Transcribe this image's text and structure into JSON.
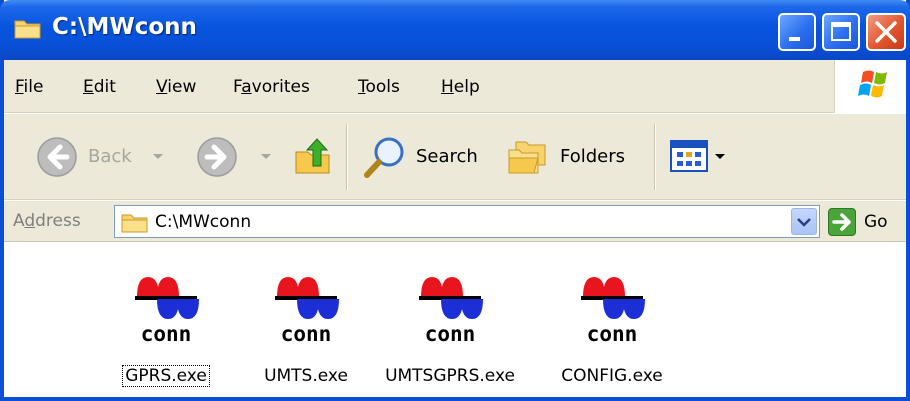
{
  "window": {
    "title": "C:\\MWconn"
  },
  "menu": [
    {
      "label": "File",
      "accel": "F",
      "rest": "ile"
    },
    {
      "label": "Edit",
      "accel": "E",
      "rest": "dit"
    },
    {
      "label": "View",
      "accel": "V",
      "rest": "iew"
    },
    {
      "label": "Favorites",
      "pre": "F",
      "accel": "a",
      "rest": "vorites"
    },
    {
      "label": "Tools",
      "accel": "T",
      "rest": "ools"
    },
    {
      "label": "Help",
      "accel": "H",
      "rest": "elp"
    }
  ],
  "toolbar": {
    "back_label": "Back",
    "search_label": "Search",
    "folders_label": "Folders"
  },
  "address": {
    "label_pre": "A",
    "label_accel": "d",
    "label_rest": "dress",
    "value": "C:\\MWconn",
    "go_label": "Go"
  },
  "files": [
    {
      "name": "GPRS.exe",
      "icon_text": "conn",
      "selected": true
    },
    {
      "name": "UMTS.exe",
      "icon_text": "conn",
      "selected": false
    },
    {
      "name": "UMTSGPRS.exe",
      "icon_text": "conn",
      "selected": false
    },
    {
      "name": "CONFIG.exe",
      "icon_text": "conn",
      "selected": false
    }
  ],
  "colors": {
    "titlebar": "#0a50d8",
    "chrome": "#ece9d8",
    "icon_red": "#e8141e",
    "icon_blue": "#1c2fd6"
  }
}
